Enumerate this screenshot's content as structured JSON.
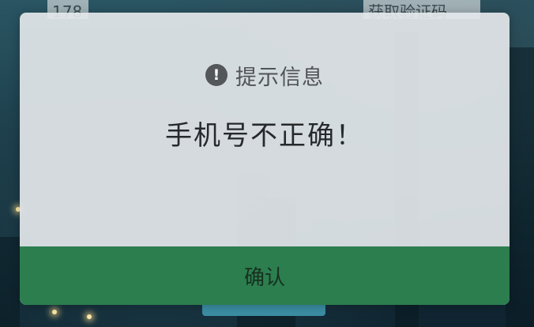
{
  "background": {
    "phone_field_text": "178",
    "code_button_text": "获取验证码",
    "colors": {
      "sky": "#2a5563",
      "submit_button": "#3c8fa6"
    }
  },
  "dialog": {
    "icon": "exclamation-circle-icon",
    "icon_glyph": "!",
    "title": "提示信息",
    "message": "手机号不正确！",
    "confirm_label": "确认",
    "colors": {
      "panel": "#e2e6e9",
      "confirm_bar": "#2c7e4f",
      "icon": "#545759"
    }
  }
}
